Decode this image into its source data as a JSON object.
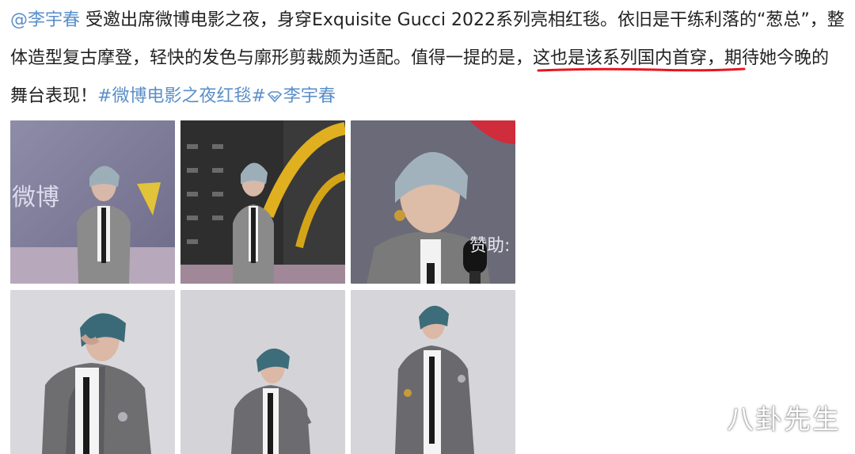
{
  "post": {
    "mention": "@李宇春",
    "line1_text": " 受邀出席微博电影之夜，身穿Exquisite Gucci 2022系列亮相红毯。依旧是干练利落的“葱总”，整",
    "line2_a": "体造型复古摩登，轻快的发色与廓形剪裁颇为适配。值得一提的是",
    "line2_b": "，这也是该系列国内首穿，",
    "line2_c": "期待她今晚的",
    "line3_text": "舞台表现！",
    "hashtag_topic": "#微博电影之夜红毯#",
    "hashtag_user": "李宇春"
  },
  "photos": [
    {
      "overlay_text": "微博"
    },
    {
      "overlay_text": ""
    },
    {
      "overlay_text": "赞助:"
    },
    {
      "overlay_text": ""
    },
    {
      "overlay_text": ""
    },
    {
      "overlay_text": ""
    }
  ],
  "watermark": "八卦先生",
  "colors": {
    "link": "#5a8fc8",
    "text": "#222222",
    "underline": "#e8141c"
  }
}
